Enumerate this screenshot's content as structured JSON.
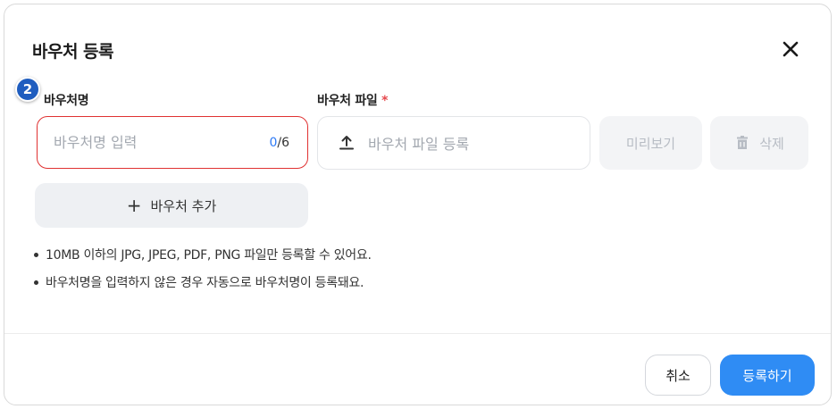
{
  "modal": {
    "title": "바우처 등록"
  },
  "step_badge": "2",
  "voucher_name": {
    "label": "바우처명",
    "placeholder": "바우처명 입력",
    "value": "",
    "count_current": "0",
    "count_max": "/6"
  },
  "voucher_file": {
    "label": "바우처 파일",
    "required_mark": "*",
    "placeholder": "바우처 파일 등록"
  },
  "buttons": {
    "preview": "미리보기",
    "delete": "삭제",
    "add_voucher": "바우처 추가",
    "cancel": "취소",
    "submit": "등록하기"
  },
  "notes": [
    "10MB 이하의 JPG, JPEG, PDF, PNG 파일만 등록할 수 있어요.",
    "바우처명을 입력하지 않은 경우 자동으로 바우처명이 등록돼요."
  ],
  "icons": {
    "close": "close-icon",
    "upload": "upload-icon",
    "trash": "trash-icon",
    "plus": "plus-icon"
  },
  "colors": {
    "accent": "#2f8cf4",
    "error_border": "#e03131",
    "required": "#e5484d",
    "badge": "#1f5dbf",
    "counter": "#2f7bf5"
  }
}
